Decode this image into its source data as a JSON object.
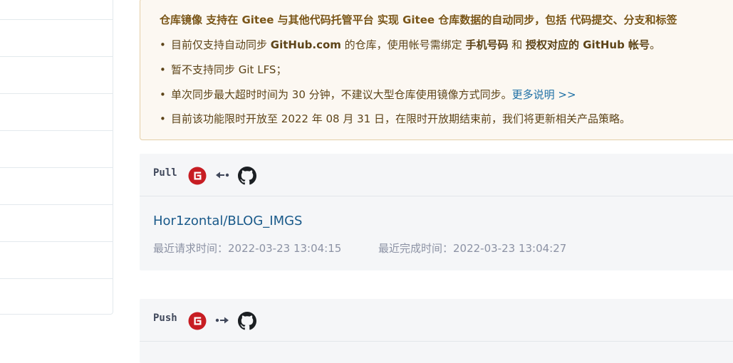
{
  "notice": {
    "headline": "仓库镜像 支持在 Gitee 与其他代码托管平台 实现 Gitee 仓库数据的自动同步，包括 代码提交、分支和标签",
    "item1": {
      "pre": "目前仅支持自动同步 ",
      "b1": "GitHub.com",
      "mid1": " 的仓库，使用帐号需绑定 ",
      "b2": "手机号码",
      "mid2": " 和 ",
      "b3": "授权对应的 GitHub 帐号",
      "post": "。"
    },
    "item2": "暂不支持同步 Git LFS；",
    "item3": {
      "text": "单次同步最大超时时间为 30 分钟，不建议大型仓库使用镜像方式同步。",
      "link": "更多说明 >>"
    },
    "item4": "目前该功能限时开放至 2022 年 08 月 31 日，在限时开放期结束前，我们将更新相关产品策略。"
  },
  "pull": {
    "label": "Pull",
    "repo": "Hor1zontal/BLOG_IMGS",
    "last_request": "最近请求时间：2022-03-23 13:04:15",
    "last_complete": "最近完成时间：2022-03-23 13:04:27"
  },
  "push": {
    "label": "Push"
  },
  "icons": {
    "gitee": "gitee-icon",
    "github": "github-icon",
    "pull_arrow": "arrow-left-icon",
    "push_arrow": "arrow-right-icon"
  },
  "colors": {
    "gitee_red": "#c71d23",
    "link_blue": "#1d6fa5",
    "notice_bg": "#fcf8f2",
    "panel_bg": "#f5f6f8"
  }
}
